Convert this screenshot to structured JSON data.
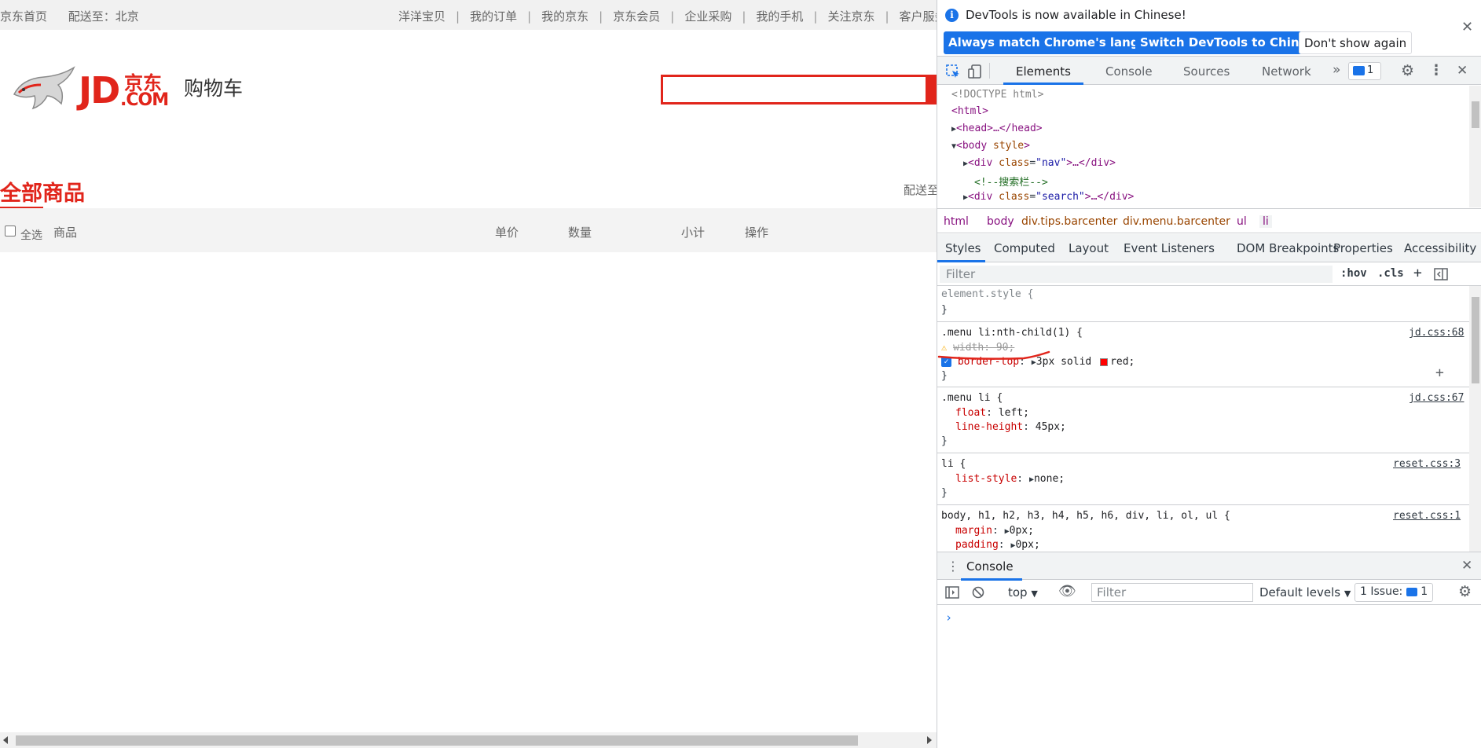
{
  "page": {
    "topnav_left": [
      "京东首页",
      "配送至：北京"
    ],
    "topnav_right": [
      "洋洋宝贝",
      "我的订单",
      "我的京东",
      "京东会员",
      "企业采购",
      "我的手机",
      "关注京东",
      "客户服务"
    ],
    "logo_jd": "JD",
    "logo_cn": "京东",
    "logo_com": ".COM",
    "cart_title": "购物车",
    "all_goods": "全部商品",
    "ship_to": "配送至",
    "cart_head": {
      "select_all": "全选",
      "goods": "商品",
      "unit_price": "单价",
      "quantity": "数量",
      "subtotal": "小计",
      "action": "操作"
    },
    "colors": {
      "brand_red": "#e1251b"
    }
  },
  "devtools": {
    "info": {
      "message": "DevTools is now available in Chinese!",
      "btn_match": "Always match Chrome's language",
      "btn_switch": "Switch DevTools to Chinese",
      "btn_dismiss": "Don't show again"
    },
    "tabs": [
      "Elements",
      "Console",
      "Sources",
      "Network"
    ],
    "issues_count": "1",
    "dom": {
      "doctype": "<!DOCTYPE html>",
      "html": "<html>",
      "head": "<head>…</head>",
      "body_tag": "body",
      "body_attr": "style",
      "div": "div",
      "class_attr": "class",
      "nav_val": "\"nav\"",
      "ellipsis_close": ">…</div>",
      "comment": "<!--搜索栏-->",
      "search_val": "\"search\""
    },
    "breadcrumbs": [
      "html",
      "body",
      "div.tips.barcenter",
      "div.menu.barcenter",
      "ul",
      "li"
    ],
    "subtabs": [
      "Styles",
      "Computed",
      "Layout",
      "Event Listeners",
      "DOM Breakpoints",
      "Properties",
      "Accessibility"
    ],
    "filter_placeholder": "Filter",
    "hov": ":hov",
    "cls": ".cls",
    "styles": {
      "element_style": "element.style {",
      "close_brace": "}",
      "rule1_sel": ".menu li:nth-child(1) {",
      "rule1_src": "jd.css:68",
      "rule1_p1": "width: 90;",
      "rule1_p2_name": "border-top",
      "rule1_p2_val_a": "3px solid",
      "rule1_p2_val_b": "red;",
      "rule2_sel": ".menu li {",
      "rule2_src": "jd.css:67",
      "rule2_p1_name": "float",
      "rule2_p1_val": "left;",
      "rule2_p2_name": "line-height",
      "rule2_p2_val": "45px;",
      "rule3_sel": "li {",
      "rule3_src": "reset.css:3",
      "rule3_p1_name": "list-style",
      "rule3_p1_val": "none;",
      "rule4_sel": "body, h1, h2, h3, h4, h5, h6, div, li, ol, ul {",
      "rule4_src": "reset.css:1",
      "rule4_p1_name": "margin",
      "rule4_p1_val": "0px;",
      "rule4_p2_name": "padding",
      "rule4_p2_val": "0px;"
    },
    "drawer": {
      "title": "Console",
      "context": "top",
      "filter": "Filter",
      "levels": "Default levels",
      "issues": "1 Issue:",
      "issues_count": "1",
      "prompt": "›"
    }
  }
}
